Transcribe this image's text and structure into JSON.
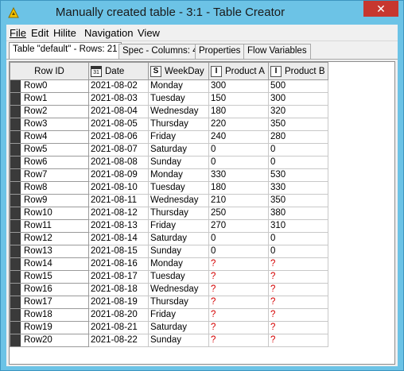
{
  "window": {
    "title": "Manually created table - 3:1 - Table Creator",
    "close_label": "✕",
    "app_icon": "knime-triangle-icon"
  },
  "menu": [
    {
      "label": "File"
    },
    {
      "label": "Edit"
    },
    {
      "label": "Hilite"
    },
    {
      "label": "Navigation"
    },
    {
      "label": "View"
    }
  ],
  "tabs": [
    {
      "label": "Table \"default\" - Rows: 21",
      "active": true
    },
    {
      "label": "Spec - Columns: 4",
      "active": false
    },
    {
      "label": "Properties",
      "active": false
    },
    {
      "label": "Flow Variables",
      "active": false
    }
  ],
  "table": {
    "columns": [
      {
        "label": "Row ID",
        "type_icon": ""
      },
      {
        "label": "Date",
        "type_icon": "calendar-icon"
      },
      {
        "label": "WeekDay",
        "type_icon": "S"
      },
      {
        "label": "Product A",
        "type_icon": "I"
      },
      {
        "label": "Product B",
        "type_icon": "I"
      }
    ],
    "rows": [
      [
        "Row0",
        "2021-08-02",
        "Monday",
        "300",
        "500"
      ],
      [
        "Row1",
        "2021-08-03",
        "Tuesday",
        "150",
        "300"
      ],
      [
        "Row2",
        "2021-08-04",
        "Wednesday",
        "180",
        "320"
      ],
      [
        "Row3",
        "2021-08-05",
        "Thursday",
        "220",
        "350"
      ],
      [
        "Row4",
        "2021-08-06",
        "Friday",
        "240",
        "280"
      ],
      [
        "Row5",
        "2021-08-07",
        "Saturday",
        "0",
        "0"
      ],
      [
        "Row6",
        "2021-08-08",
        "Sunday",
        "0",
        "0"
      ],
      [
        "Row7",
        "2021-08-09",
        "Monday",
        "330",
        "530"
      ],
      [
        "Row8",
        "2021-08-10",
        "Tuesday",
        "180",
        "330"
      ],
      [
        "Row9",
        "2021-08-11",
        "Wednesday",
        "210",
        "350"
      ],
      [
        "Row10",
        "2021-08-12",
        "Thursday",
        "250",
        "380"
      ],
      [
        "Row11",
        "2021-08-13",
        "Friday",
        "270",
        "310"
      ],
      [
        "Row12",
        "2021-08-14",
        "Saturday",
        "0",
        "0"
      ],
      [
        "Row13",
        "2021-08-15",
        "Sunday",
        "0",
        "0"
      ],
      [
        "Row14",
        "2021-08-16",
        "Monday",
        "?",
        "?"
      ],
      [
        "Row15",
        "2021-08-17",
        "Tuesday",
        "?",
        "?"
      ],
      [
        "Row16",
        "2021-08-18",
        "Wednesday",
        "?",
        "?"
      ],
      [
        "Row17",
        "2021-08-19",
        "Thursday",
        "?",
        "?"
      ],
      [
        "Row18",
        "2021-08-20",
        "Friday",
        "?",
        "?"
      ],
      [
        "Row19",
        "2021-08-21",
        "Saturday",
        "?",
        "?"
      ],
      [
        "Row20",
        "2021-08-22",
        "Sunday",
        "?",
        "?"
      ]
    ],
    "missing_value": "?",
    "missing_color": "#d40000"
  }
}
